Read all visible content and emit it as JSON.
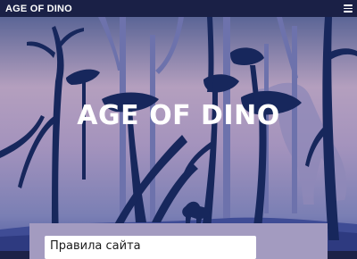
{
  "header": {
    "brand": "AGE OF DINO",
    "menu_icon": "hamburger-menu-icon"
  },
  "hero": {
    "title": "AGE OF DINO"
  },
  "content": {
    "field_value": "Правила сайта"
  },
  "colors": {
    "topbar": "#1a2046",
    "sky_top": "#5b6596",
    "sky_mid": "#b49fbe",
    "ground": "#3f4c95",
    "trees_far": "#6d72ac",
    "trees_near": "#17275c",
    "panel": "#a39bc0"
  }
}
